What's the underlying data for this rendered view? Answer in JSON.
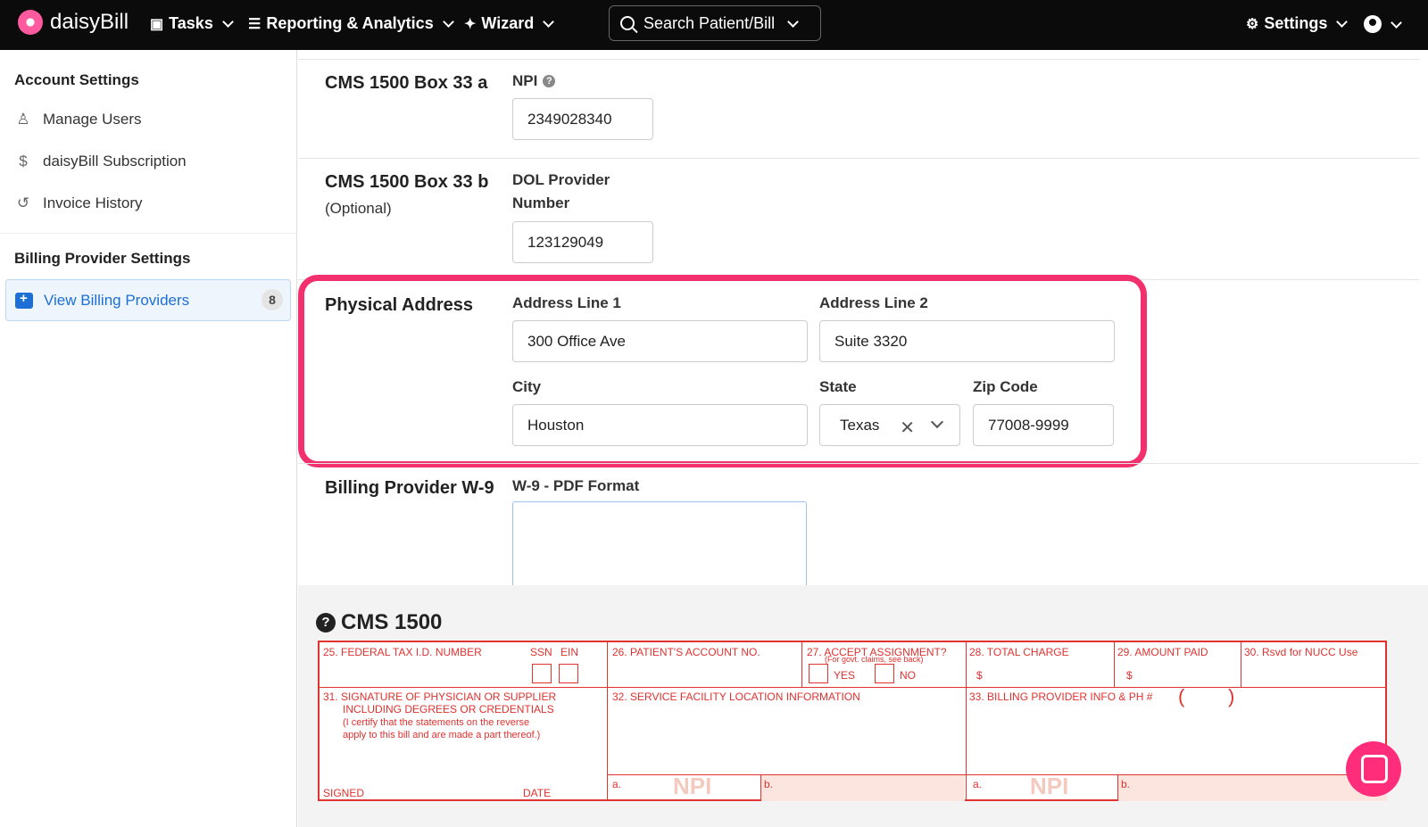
{
  "topnav": {
    "brand": "daisyBill",
    "tasks": "Tasks",
    "reporting": "Reporting & Analytics",
    "wizard": "Wizard",
    "search": "Search Patient/Bill",
    "settings": "Settings"
  },
  "sidebar": {
    "account_heading": "Account Settings",
    "manage_users": "Manage Users",
    "subscription": "daisyBill Subscription",
    "invoice_history": "Invoice History",
    "billing_heading": "Billing Provider Settings",
    "view_providers": "View Billing Providers",
    "providers_count": "8"
  },
  "main": {
    "box33a_title": "CMS 1500 Box 33 a",
    "npi_label": "NPI",
    "npi_value": "2349028340",
    "box33b_title": "CMS 1500 Box 33 b",
    "box33b_sub": "(Optional)",
    "dol_label_1": "DOL Provider",
    "dol_label_2": "Number",
    "dol_value": "123129049",
    "address_title": "Physical Address",
    "addr1_label": "Address Line 1",
    "addr1_value": "300 Office Ave",
    "addr2_label": "Address Line 2",
    "addr2_value": "Suite 3320",
    "city_label": "City",
    "city_value": "Houston",
    "state_label": "State",
    "state_value": "Texas",
    "zip_label": "Zip Code",
    "zip_value": "77008-9999",
    "w9_title": "Billing Provider W-9",
    "w9_label": "W-9 - PDF Format"
  },
  "cms": {
    "title": "CMS 1500",
    "c25": "25. FEDERAL TAX I.D. NUMBER",
    "ssn": "SSN",
    "ein": "EIN",
    "c26": "26. PATIENT'S ACCOUNT NO.",
    "c27": "27. ACCEPT ASSIGNMENT?",
    "c27_sub": "(For govt. claims, see back)",
    "yes": "YES",
    "no": "NO",
    "c28": "28. TOTAL CHARGE",
    "c29": "29. AMOUNT PAID",
    "c30": "30. Rsvd for NUCC Use",
    "dollar": "$",
    "c31_1": "31. SIGNATURE OF PHYSICIAN OR SUPPLIER",
    "c31_2": "INCLUDING DEGREES OR CREDENTIALS",
    "c31_3": "(I certify that the statements on the reverse",
    "c31_4": "apply to this bill and are made a part thereof.)",
    "signed": "SIGNED",
    "date": "DATE",
    "c32": "32. SERVICE FACILITY LOCATION INFORMATION",
    "c33": "33. BILLING PROVIDER INFO & PH #",
    "paren_open": "(",
    "paren_close": ")",
    "a": "a.",
    "b": "b.",
    "npi": "NPI"
  }
}
